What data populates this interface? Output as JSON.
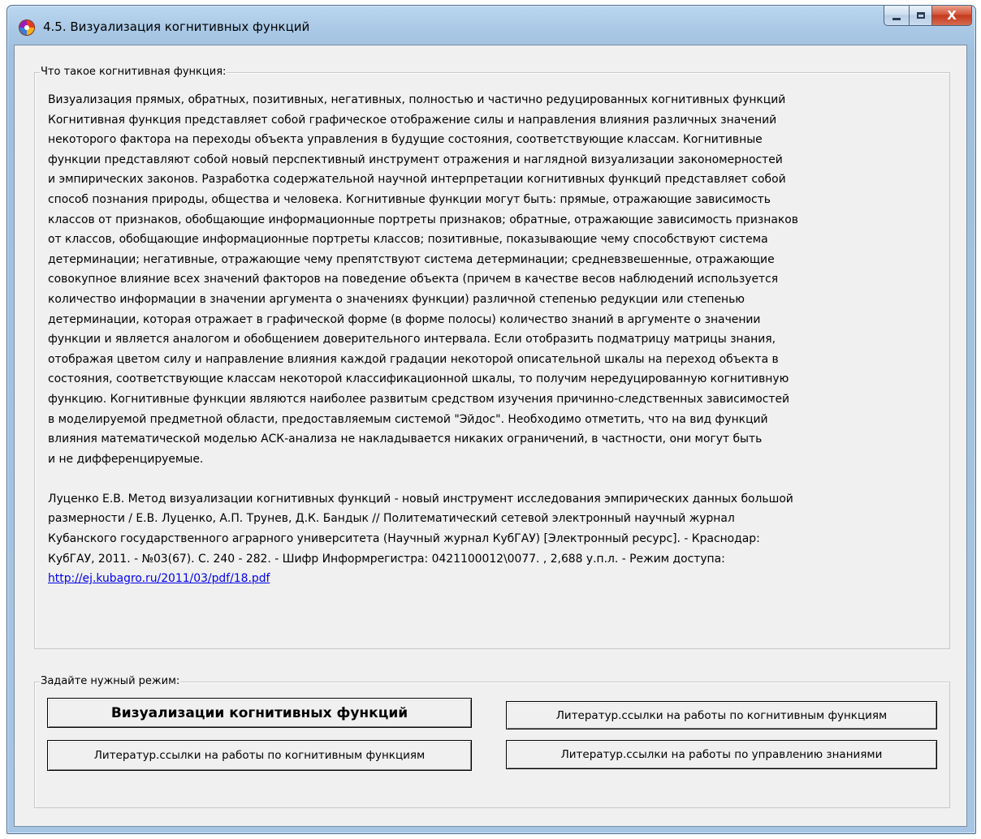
{
  "window": {
    "title": "4.5. Визуализация когнитивных функций",
    "controls": {
      "minimize": "",
      "maximize": "",
      "close": "X"
    }
  },
  "description_group": {
    "legend": "Что такое когнитивная функция:",
    "lines": [
      "Визуализация прямых, обратных, позитивных, негативных, полностью и частично редуцированных когнитивных функций",
      "Когнитивная функция представляет собой графическое отображение силы и направления влияния различных значений",
      "некоторого фактора на переходы объекта управления в будущие состояния, соответствующие классам. Когнитивные",
      "функции представляют собой новый перспективный инструмент отражения и наглядной визуализации закономерностей",
      "и эмпирических законов. Разработка содержательной научной интерпретации когнитивных функций представляет собой",
      "способ познания природы, общества и человека. Когнитивные функции могут быть: прямые, отражающие зависимость",
      "классов от признаков, обобщающие информационные портреты признаков; обратные, отражающие зависимость признаков",
      "от классов, обобщающие информационные портреты классов; позитивные, показывающие чему способствуют система",
      "детерминации; негативные, отражающие чему препятствуют система детерминации; средневзвешенные, отражающие",
      "совокупное влияние всех значений факторов на поведение объекта (причем в качестве весов наблюдений используется",
      "количество информации в значении аргумента о значениях функции) различной степенью редукции или степенью",
      "детерминации, которая отражает в графической форме (в форме полосы) количество знаний в аргументе о значении",
      "функции и является аналогом и обобщением доверительного интервала. Если отобразить подматрицу матрицы знания,",
      "отображая цветом силу и направление влияния каждой градации некоторой описательной шкалы на переход объекта в",
      "состояния, соответствующие классам некоторой классификационной шкалы, то получим нередуцированную когнитивную",
      "функцию. Когнитивные функции являются наиболее развитым средством изучения причинно-следственных зависимостей",
      "в моделируемой предметной области, предоставляемым системой \"Эйдос\". Необходимо отметить, что на вид функций",
      "влияния математической моделью АСК-анализа не накладывается никаких ограничений, в частности, они могут быть",
      "и не дифференцируемые."
    ],
    "reference_lines": [
      "Луценко Е.В. Метод визуализации когнитивных функций - новый инструмент исследования эмпирических данных большой",
      "размерности / Е.В. Луценко, А.П. Трунев, Д.К. Бандык // Политематический сетевой электронный научный журнал",
      "Кубанского государственного аграрного университета (Научный журнал КубГАУ) [Электронный ресурс]. - Краснодар:",
      "КубГАУ, 2011. - №03(67). С. 240 - 282. - Шифр Информрегистра: 0421100012\\0077. , 2,688 у.п.л. - Режим доступа:"
    ],
    "reference_link": "http://ej.kubagro.ru/2011/03/pdf/18.pdf"
  },
  "mode_group": {
    "legend": "Задайте нужный режим:",
    "buttons": {
      "visualize": "Визуализации когнитивных функций",
      "lit_cognitive_right": "Литератур.ссылки на работы по когнитивным функциям",
      "lit_cognitive_left": "Литератур.ссылки на работы по когнитивным функциям",
      "lit_knowledge_mgmt": "Литератур.ссылки на работы по управлению знаниями"
    }
  }
}
